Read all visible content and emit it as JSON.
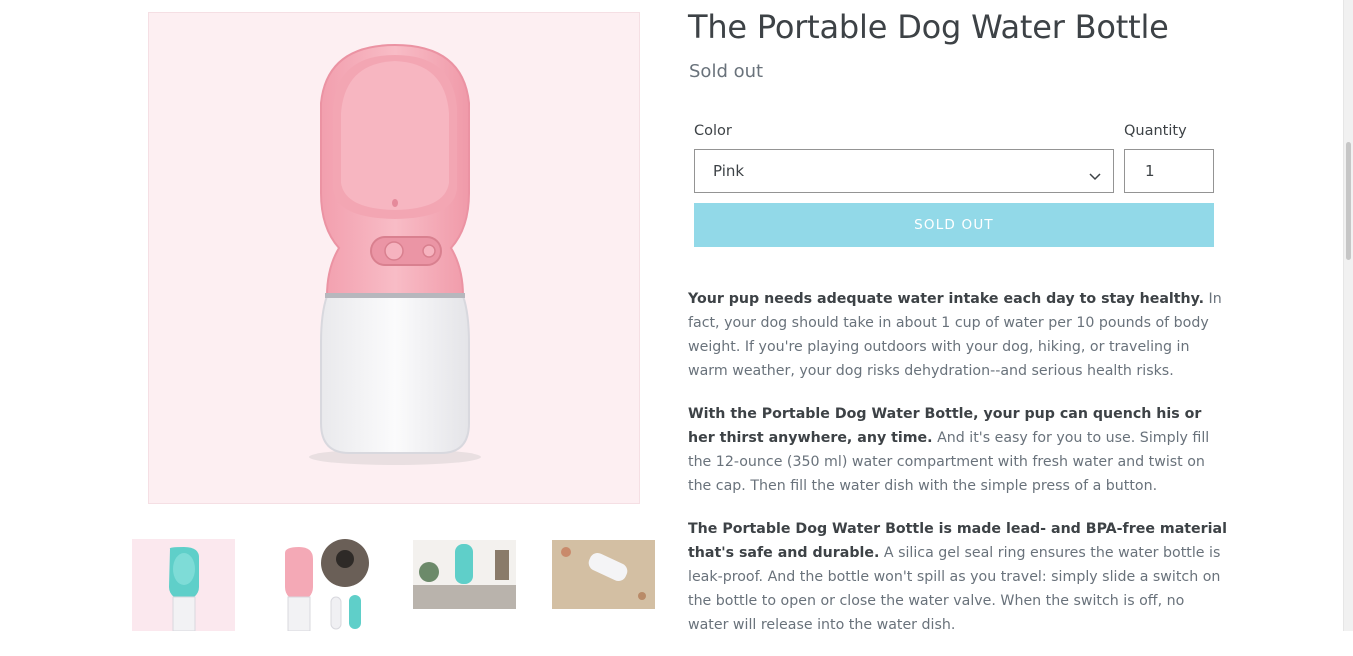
{
  "product": {
    "title": "The Portable Dog Water Bottle",
    "status": "Sold out"
  },
  "options": {
    "color_label": "Color",
    "color_value": "Pink",
    "quantity_label": "Quantity",
    "quantity_value": "1"
  },
  "buttons": {
    "add_to_cart_label": "SOLD OUT"
  },
  "description": {
    "p1_bold": " Your pup needs adequate water intake each day to stay healthy.",
    "p1_text": " In fact, your dog should take in about 1 cup of water per 10 pounds of body weight. If you're playing outdoors with your dog, hiking, or traveling in warm weather, your dog risks dehydration--and serious health risks.",
    "p2_bold": "With the Portable Dog Water Bottle, your pup can quench his or her thirst anywhere, any time.",
    "p2_text": " And it's easy for you to use. Simply fill the 12-ounce (350 ml) water compartment with fresh water and twist on the cap. Then fill the water dish with the simple press of a button.",
    "p3_bold": "The Portable Dog Water Bottle is made lead- and BPA-free material that's safe and durable.",
    "p3_text": " A silica gel seal ring ensures the water bottle is leak-proof. And the bottle won't spill as you travel: simply slide a switch on the bottle to open or close the water valve. When the switch is off, no water will release into the water dish."
  },
  "colors": {
    "sold_out_button": "#92d9e8",
    "bottle_pink": "#f4a9b6",
    "bottle_teal": "#5fcfc9"
  }
}
